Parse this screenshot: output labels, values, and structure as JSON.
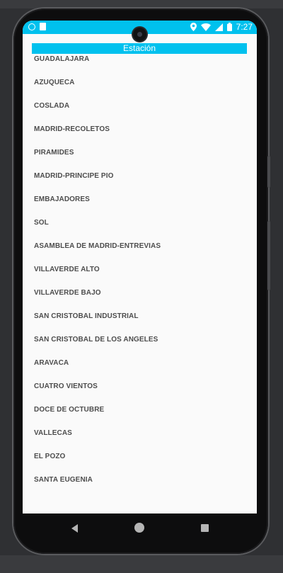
{
  "status_bar": {
    "time": "7:27",
    "left_icons": [
      "sync-icon",
      "sd-card-icon"
    ],
    "right_icons": [
      "location-icon",
      "wifi-icon",
      "signal-icon",
      "battery-icon"
    ]
  },
  "header": {
    "title": "Estación"
  },
  "stations": [
    "GUADALAJARA",
    "AZUQUECA",
    "COSLADA",
    "MADRID-RECOLETOS",
    "PIRAMIDES",
    "MADRID-PRINCIPE PIO",
    "EMBAJADORES",
    "SOL",
    "ASAMBLEA DE MADRID-ENTREVIAS",
    "VILLAVERDE ALTO",
    "VILLAVERDE BAJO",
    "SAN CRISTOBAL INDUSTRIAL",
    "SAN CRISTOBAL DE LOS ANGELES",
    "ARAVACA",
    "CUATRO VIENTOS",
    "DOCE DE OCTUBRE",
    "VALLECAS",
    "EL POZO",
    "SANTA EUGENIA"
  ],
  "nav_bar": {
    "icons": [
      "back-icon",
      "home-icon",
      "recents-icon"
    ]
  },
  "colors": {
    "accent": "#00c1ee",
    "screen_bg": "#fafafa",
    "item_text": "#4d4d4d"
  }
}
